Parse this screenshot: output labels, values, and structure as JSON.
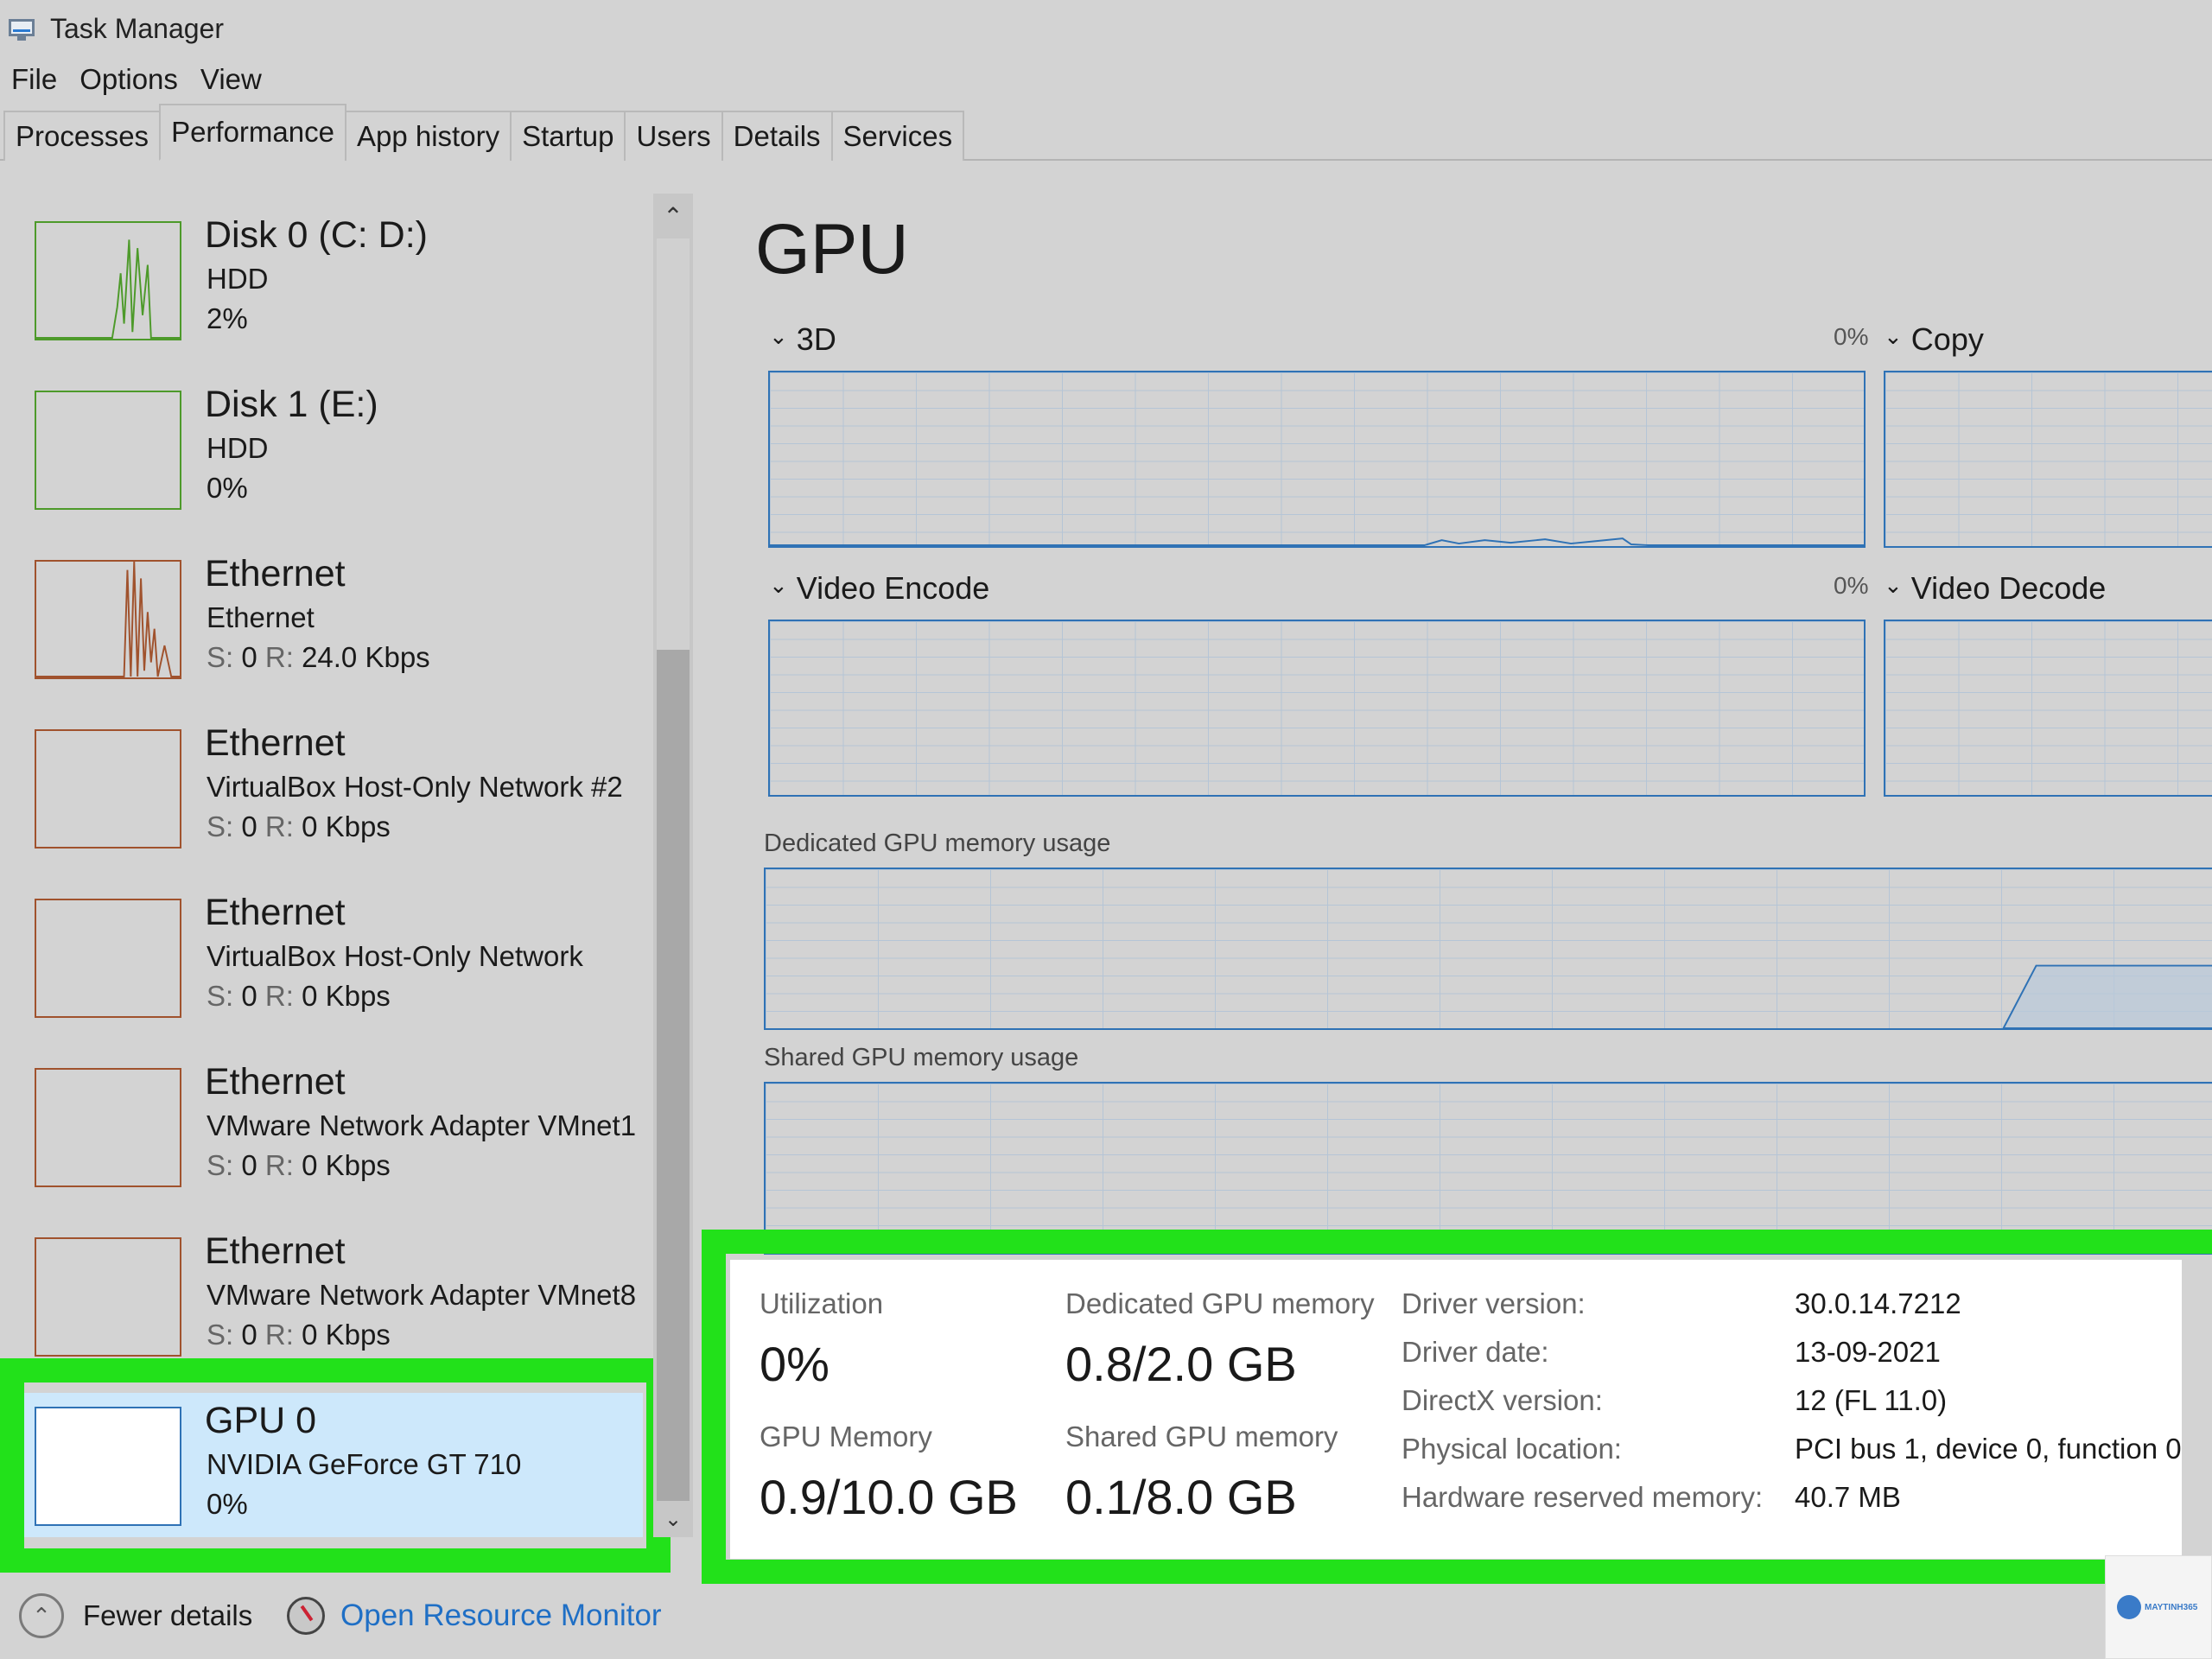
{
  "window": {
    "title": "Task Manager"
  },
  "menu": [
    "File",
    "Options",
    "View"
  ],
  "tabs": [
    {
      "label": "Processes",
      "active": false
    },
    {
      "label": "Performance",
      "active": true
    },
    {
      "label": "App history",
      "active": false
    },
    {
      "label": "Startup",
      "active": false
    },
    {
      "label": "Users",
      "active": false
    },
    {
      "label": "Details",
      "active": false
    },
    {
      "label": "Services",
      "active": false
    }
  ],
  "sidebar": {
    "items": [
      {
        "name": "Disk 0 (C: D:)",
        "sub": "HDD",
        "stat": "2%",
        "color": "#4d9a2a"
      },
      {
        "name": "Disk 1 (E:)",
        "sub": "HDD",
        "stat": "0%",
        "color": "#4d9a2a"
      },
      {
        "name": "Ethernet",
        "sub": "Ethernet",
        "stat_s_label": "S:",
        "stat_s": "0",
        "stat_r_label": "R:",
        "stat_r": "24.0 Kbps",
        "color": "#a0522d"
      },
      {
        "name": "Ethernet",
        "sub": "VirtualBox Host-Only Network #2",
        "stat_s_label": "S:",
        "stat_s": "0",
        "stat_r_label": "R:",
        "stat_r": "0 Kbps",
        "color": "#a0522d"
      },
      {
        "name": "Ethernet",
        "sub": "VirtualBox Host-Only Network",
        "stat_s_label": "S:",
        "stat_s": "0",
        "stat_r_label": "R:",
        "stat_r": "0 Kbps",
        "color": "#a0522d"
      },
      {
        "name": "Ethernet",
        "sub": "VMware Network Adapter VMnet1",
        "stat_s_label": "S:",
        "stat_s": "0",
        "stat_r_label": "R:",
        "stat_r": "0 Kbps",
        "color": "#a0522d"
      },
      {
        "name": "Ethernet",
        "sub": "VMware Network Adapter VMnet8",
        "stat_s_label": "S:",
        "stat_s": "0",
        "stat_r_label": "R:",
        "stat_r": "0 Kbps",
        "color": "#a0522d"
      },
      {
        "name": "GPU 0",
        "sub": "NVIDIA GeForce GT 710",
        "stat": "0%",
        "color": "#2f72b5",
        "selected": true
      }
    ]
  },
  "gpu": {
    "title": "GPU",
    "engines": [
      {
        "label": "3D",
        "pct": "0%"
      },
      {
        "label": "Copy",
        "pct": ""
      },
      {
        "label": "Video Encode",
        "pct": "0%"
      },
      {
        "label": "Video Decode",
        "pct": ""
      }
    ],
    "dedicated_label": "Dedicated GPU memory usage",
    "shared_label": "Shared GPU memory usage",
    "stats": {
      "utilization_label": "Utilization",
      "utilization": "0%",
      "dedicated_label": "Dedicated GPU memory",
      "dedicated": "0.8/2.0 GB",
      "gpu_memory_label": "GPU Memory",
      "gpu_memory": "0.9/10.0 GB",
      "shared_label": "Shared GPU memory",
      "shared": "0.1/8.0 GB"
    },
    "info": [
      {
        "key": "Driver version:",
        "value": "30.0.14.7212"
      },
      {
        "key": "Driver date:",
        "value": "13-09-2021"
      },
      {
        "key": "DirectX version:",
        "value": "12 (FL 11.0)"
      },
      {
        "key": "Physical location:",
        "value": "PCI bus 1, device 0, function 0"
      },
      {
        "key": "Hardware reserved memory:",
        "value": "40.7 MB"
      }
    ]
  },
  "footer": {
    "fewer_details": "Fewer details",
    "open_resmon": "Open Resource Monitor"
  },
  "colors": {
    "highlight": "#22e11a",
    "link": "#1f6fc5",
    "graph": "#2f72b5",
    "selected_bg": "#cde8fb"
  },
  "watermark": {
    "text": "MAYTINH365"
  }
}
